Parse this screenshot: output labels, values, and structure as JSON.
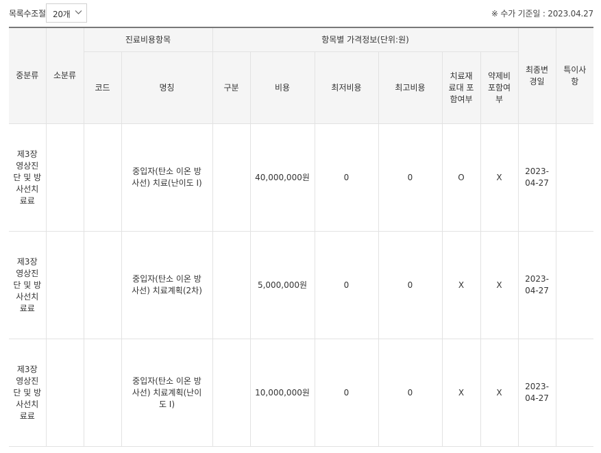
{
  "toolbar": {
    "list_count_label": "목록수조절",
    "list_count_value": "20개",
    "basis_text": "※ 수가 기준일 : 2023.04.27"
  },
  "table": {
    "headers": {
      "major": "중분류",
      "minor": "소분류",
      "group_treatment": "진료비용항목",
      "group_price": "항목별 가격정보(단위:원)",
      "last_modified": "최종변경일",
      "notes": "특이사항",
      "code": "코드",
      "name": "명칭",
      "division": "구분",
      "cost": "비용",
      "min_cost": "최저비용",
      "max_cost": "최고비용",
      "material_included": "치료재료대 포함여부",
      "drug_included": "약제비 포함여부"
    },
    "rows": [
      {
        "major": "제3장 영상진단 및 방사선치료료",
        "minor": "",
        "code": "",
        "name": "중입자(탄소 이온 방사선) 치료(난이도 I)",
        "division": "",
        "cost": "40,000,000원",
        "min_cost": "0",
        "max_cost": "0",
        "material_included": "O",
        "drug_included": "X",
        "last_modified": "2023-04-27",
        "notes": ""
      },
      {
        "major": "제3장 영상진단 및 방사선치료료",
        "minor": "",
        "code": "",
        "name": "중입자(탄소 이온 방사선) 치료계획(2차)",
        "division": "",
        "cost": "5,000,000원",
        "min_cost": "0",
        "max_cost": "0",
        "material_included": "X",
        "drug_included": "X",
        "last_modified": "2023-04-27",
        "notes": ""
      },
      {
        "major": "제3장 영상진단 및 방사선치료료",
        "minor": "",
        "code": "",
        "name": "중입자(탄소 이온 방사선) 치료계획(난이도 I)",
        "division": "",
        "cost": "10,000,000원",
        "min_cost": "0",
        "max_cost": "0",
        "material_included": "X",
        "drug_included": "X",
        "last_modified": "2023-04-27",
        "notes": ""
      }
    ]
  }
}
